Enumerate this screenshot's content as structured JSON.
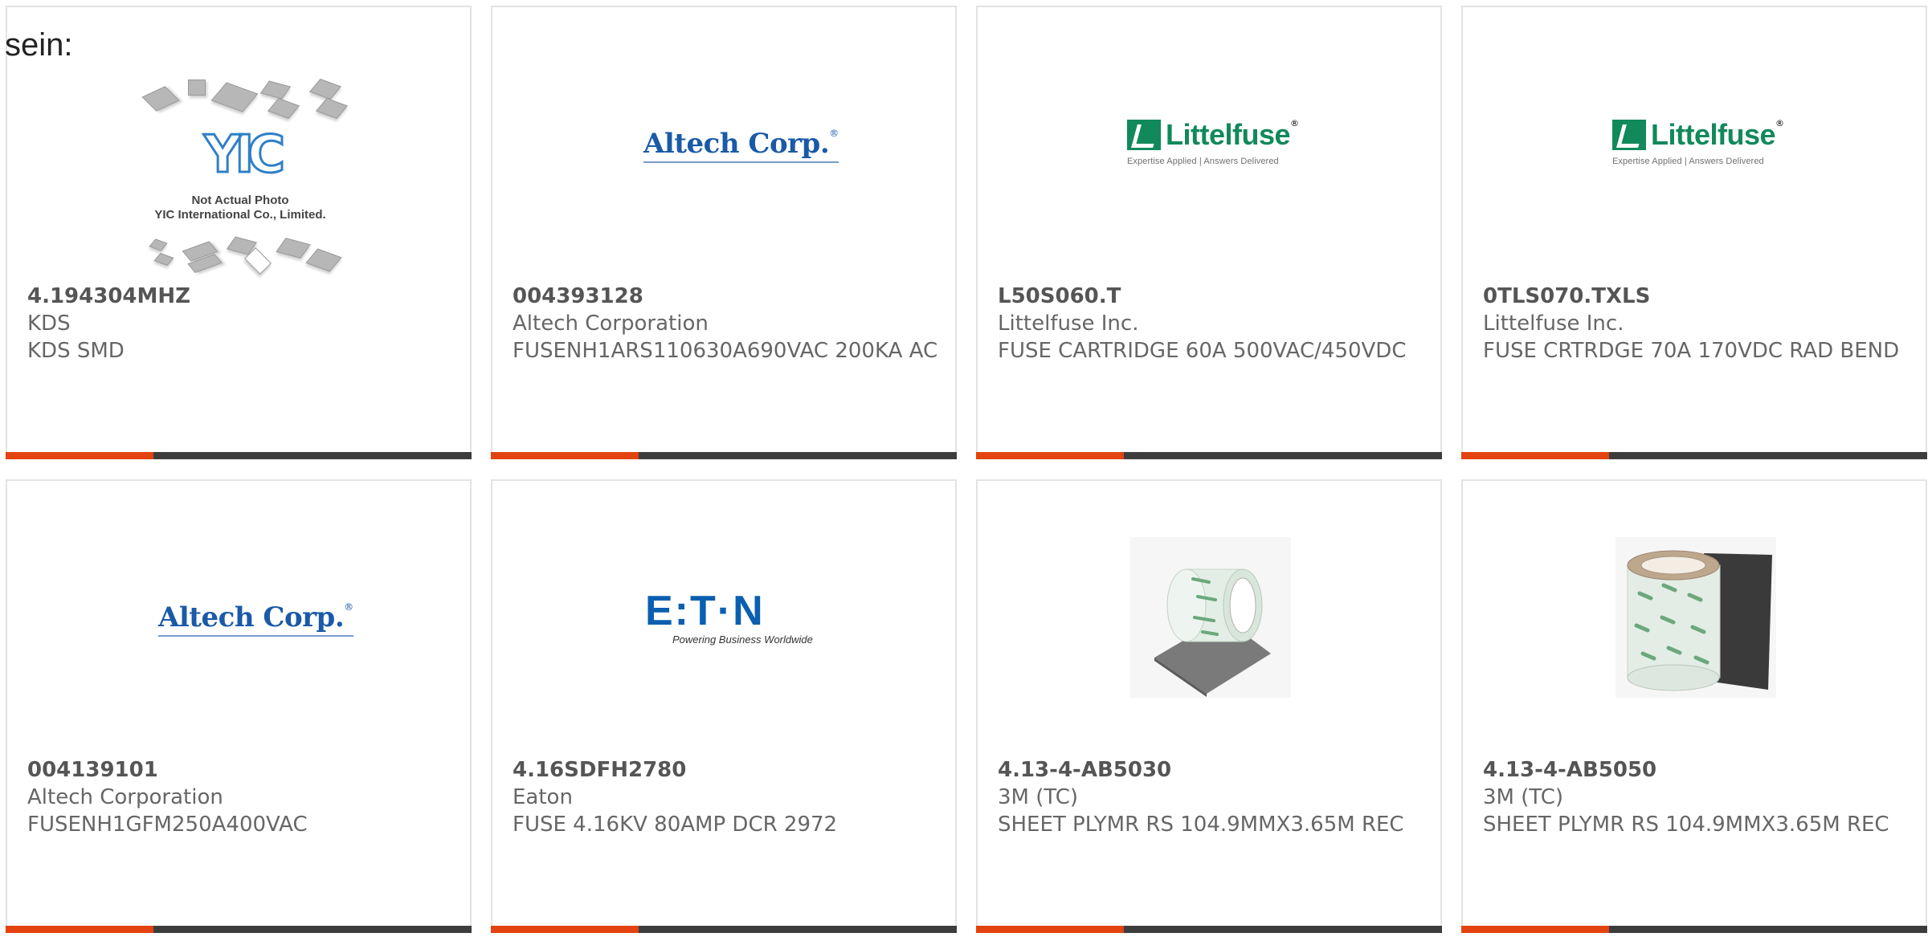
{
  "heading": "sein:",
  "products": [
    {
      "part": "4.194304MHZ",
      "manufacturer": "KDS",
      "description": "KDS SMD",
      "image": {
        "type": "yic-placeholder",
        "line1": "Not Actual Photo",
        "line2": "YIC International Co., Limited.",
        "logo_text": "YIC"
      }
    },
    {
      "part": "004393128",
      "manufacturer": "Altech Corporation",
      "description": "FUSENH1ARS110630A690VAC 200KA AC",
      "image": {
        "type": "altech-logo",
        "logo_text": "Altech Corp."
      }
    },
    {
      "part": "L50S060.T",
      "manufacturer": "Littelfuse Inc.",
      "description": "FUSE CARTRIDGE 60A 500VAC/450VDC",
      "image": {
        "type": "littelfuse-logo",
        "logo_text": "Littelfuse",
        "tagline": "Expertise Applied | Answers Delivered"
      }
    },
    {
      "part": "0TLS070.TXLS",
      "manufacturer": "Littelfuse Inc.",
      "description": "FUSE CRTRDGE 70A 170VDC RAD BEND",
      "image": {
        "type": "littelfuse-logo",
        "logo_text": "Littelfuse",
        "tagline": "Expertise Applied | Answers Delivered"
      }
    },
    {
      "part": "004139101",
      "manufacturer": "Altech Corporation",
      "description": "FUSENH1GFM250A400VAC",
      "image": {
        "type": "altech-logo",
        "logo_text": "Altech Corp."
      }
    },
    {
      "part": "4.16SDFH2780",
      "manufacturer": "Eaton",
      "description": "FUSE 4.16KV 80AMP DCR 2972",
      "image": {
        "type": "eaton-logo",
        "logo_text": "E:T·N",
        "tagline": "Powering Business Worldwide"
      }
    },
    {
      "part": "4.13-4-AB5030",
      "manufacturer": "3M (TC)",
      "description": "SHEET PLYMR RS 104.9MMX3.65M REC",
      "image": {
        "type": "tape-roll-photo"
      }
    },
    {
      "part": "4.13-4-AB5050",
      "manufacturer": "3M (TC)",
      "description": "SHEET PLYMR RS 104.9MMX3.65M REC",
      "image": {
        "type": "tape-roll-photo"
      }
    }
  ],
  "colors": {
    "accent_bar": "#e2430f",
    "bar": "#3d3d3d",
    "card_border": "#e3e3e3",
    "text": "#666666"
  }
}
